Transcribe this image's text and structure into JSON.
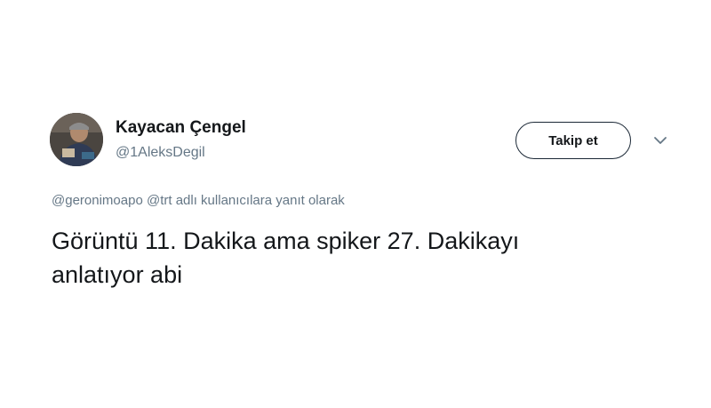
{
  "user": {
    "display_name": "Kayacan Çengel",
    "handle": "@1AleksDegil"
  },
  "follow_button": {
    "label": "Takip et"
  },
  "menu": {
    "icon": "chevron-down-icon"
  },
  "reply_context": {
    "mention_1": "@geronimoapo",
    "mention_2": "@trt",
    "suffix": "adlı kullanıcılara yanıt olarak"
  },
  "tweet": {
    "text_line_1": "Görüntü 11. Dakika ama spiker 27. Dakikayı",
    "text_line_2": "anlatıyor abi"
  },
  "colors": {
    "text_primary": "#14171a",
    "text_secondary": "#657786",
    "background": "#ffffff"
  }
}
